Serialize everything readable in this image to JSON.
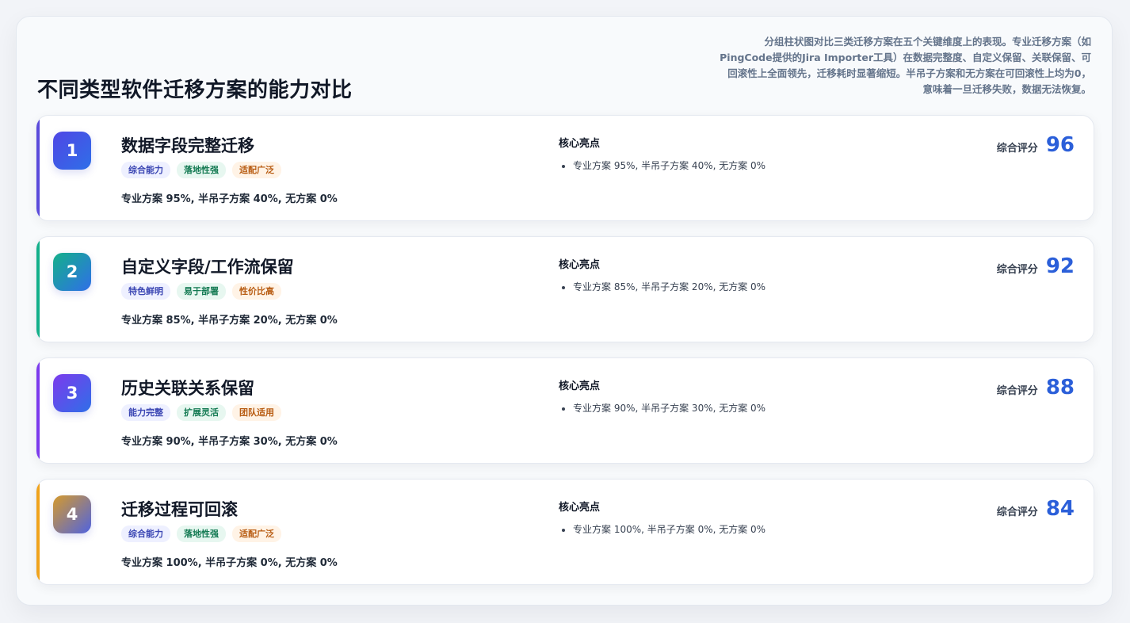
{
  "page": {
    "title": "不同类型软件迁移方案的能力对比",
    "description": "分组柱状图对比三类迁移方案在五个关键维度上的表现。专业迁移方案（如PingCode提供的Jira Importer工具）在数据完整度、自定义保留、关联保留、可回滚性上全面领先，迁移耗时显著缩短。半吊子方案和无方案在可回滚性上均为0，意味着一旦迁移失败，数据无法恢复。"
  },
  "highlight_label": "核心亮点",
  "score_label": "综合评分",
  "cards": [
    {
      "rank": "1",
      "title": "数据字段完整迁移",
      "tags": [
        "综合能力",
        "落地性强",
        "适配广泛"
      ],
      "summary": "专业方案 95%, 半吊子方案 40%, 无方案 0%",
      "highlight": "专业方案 95%, 半吊子方案 40%, 无方案 0%",
      "score": "96",
      "colors": {
        "accent": "#5b4bdb",
        "badge_from": "#4f46e5",
        "badge_to": "#2f6fe8"
      }
    },
    {
      "rank": "2",
      "title": "自定义字段/工作流保留",
      "tags": [
        "特色鲜明",
        "易于部署",
        "性价比高"
      ],
      "summary": "专业方案 85%, 半吊子方案 20%, 无方案 0%",
      "highlight": "专业方案 85%, 半吊子方案 20%, 无方案 0%",
      "score": "92",
      "colors": {
        "accent": "#14b08a",
        "badge_from": "#14b08a",
        "badge_to": "#2f6fe8"
      }
    },
    {
      "rank": "3",
      "title": "历史关联关系保留",
      "tags": [
        "能力完整",
        "扩展灵活",
        "团队适用"
      ],
      "summary": "专业方案 90%, 半吊子方案 30%, 无方案 0%",
      "highlight": "专业方案 90%, 半吊子方案 30%, 无方案 0%",
      "score": "88",
      "colors": {
        "accent": "#7c3aed",
        "badge_from": "#7c3aed",
        "badge_to": "#2f6fe8"
      }
    },
    {
      "rank": "4",
      "title": "迁移过程可回滚",
      "tags": [
        "综合能力",
        "落地性强",
        "适配广泛"
      ],
      "summary": "专业方案 100%, 半吊子方案 0%, 无方案 0%",
      "highlight": "专业方案 100%, 半吊子方案 0%, 无方案 0%",
      "score": "84",
      "colors": {
        "accent": "#f0a31c",
        "badge_from": "#d59a2c",
        "badge_to": "#4f63e0"
      }
    }
  ]
}
